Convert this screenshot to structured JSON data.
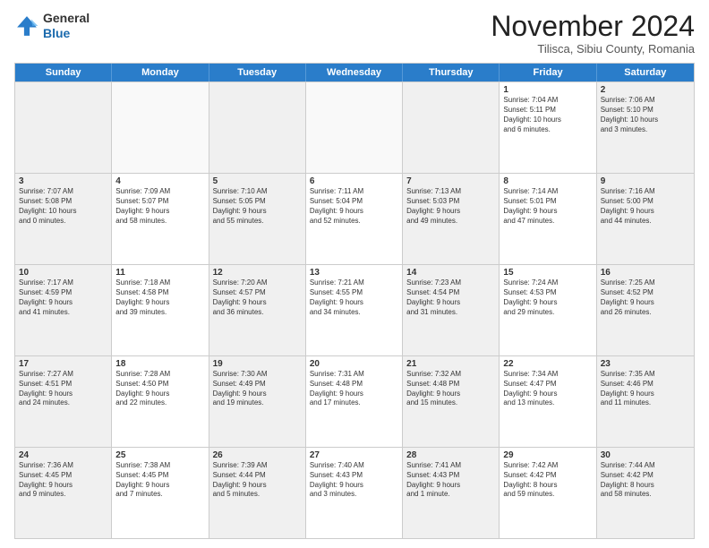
{
  "header": {
    "logo_general": "General",
    "logo_blue": "Blue",
    "month_title": "November 2024",
    "location": "Tilisca, Sibiu County, Romania"
  },
  "calendar": {
    "days": [
      "Sunday",
      "Monday",
      "Tuesday",
      "Wednesday",
      "Thursday",
      "Friday",
      "Saturday"
    ],
    "rows": [
      [
        {
          "day": "",
          "text": ""
        },
        {
          "day": "",
          "text": ""
        },
        {
          "day": "",
          "text": ""
        },
        {
          "day": "",
          "text": ""
        },
        {
          "day": "",
          "text": ""
        },
        {
          "day": "1",
          "text": "Sunrise: 7:04 AM\nSunset: 5:11 PM\nDaylight: 10 hours\nand 6 minutes."
        },
        {
          "day": "2",
          "text": "Sunrise: 7:06 AM\nSunset: 5:10 PM\nDaylight: 10 hours\nand 3 minutes."
        }
      ],
      [
        {
          "day": "3",
          "text": "Sunrise: 7:07 AM\nSunset: 5:08 PM\nDaylight: 10 hours\nand 0 minutes."
        },
        {
          "day": "4",
          "text": "Sunrise: 7:09 AM\nSunset: 5:07 PM\nDaylight: 9 hours\nand 58 minutes."
        },
        {
          "day": "5",
          "text": "Sunrise: 7:10 AM\nSunset: 5:05 PM\nDaylight: 9 hours\nand 55 minutes."
        },
        {
          "day": "6",
          "text": "Sunrise: 7:11 AM\nSunset: 5:04 PM\nDaylight: 9 hours\nand 52 minutes."
        },
        {
          "day": "7",
          "text": "Sunrise: 7:13 AM\nSunset: 5:03 PM\nDaylight: 9 hours\nand 49 minutes."
        },
        {
          "day": "8",
          "text": "Sunrise: 7:14 AM\nSunset: 5:01 PM\nDaylight: 9 hours\nand 47 minutes."
        },
        {
          "day": "9",
          "text": "Sunrise: 7:16 AM\nSunset: 5:00 PM\nDaylight: 9 hours\nand 44 minutes."
        }
      ],
      [
        {
          "day": "10",
          "text": "Sunrise: 7:17 AM\nSunset: 4:59 PM\nDaylight: 9 hours\nand 41 minutes."
        },
        {
          "day": "11",
          "text": "Sunrise: 7:18 AM\nSunset: 4:58 PM\nDaylight: 9 hours\nand 39 minutes."
        },
        {
          "day": "12",
          "text": "Sunrise: 7:20 AM\nSunset: 4:57 PM\nDaylight: 9 hours\nand 36 minutes."
        },
        {
          "day": "13",
          "text": "Sunrise: 7:21 AM\nSunset: 4:55 PM\nDaylight: 9 hours\nand 34 minutes."
        },
        {
          "day": "14",
          "text": "Sunrise: 7:23 AM\nSunset: 4:54 PM\nDaylight: 9 hours\nand 31 minutes."
        },
        {
          "day": "15",
          "text": "Sunrise: 7:24 AM\nSunset: 4:53 PM\nDaylight: 9 hours\nand 29 minutes."
        },
        {
          "day": "16",
          "text": "Sunrise: 7:25 AM\nSunset: 4:52 PM\nDaylight: 9 hours\nand 26 minutes."
        }
      ],
      [
        {
          "day": "17",
          "text": "Sunrise: 7:27 AM\nSunset: 4:51 PM\nDaylight: 9 hours\nand 24 minutes."
        },
        {
          "day": "18",
          "text": "Sunrise: 7:28 AM\nSunset: 4:50 PM\nDaylight: 9 hours\nand 22 minutes."
        },
        {
          "day": "19",
          "text": "Sunrise: 7:30 AM\nSunset: 4:49 PM\nDaylight: 9 hours\nand 19 minutes."
        },
        {
          "day": "20",
          "text": "Sunrise: 7:31 AM\nSunset: 4:48 PM\nDaylight: 9 hours\nand 17 minutes."
        },
        {
          "day": "21",
          "text": "Sunrise: 7:32 AM\nSunset: 4:48 PM\nDaylight: 9 hours\nand 15 minutes."
        },
        {
          "day": "22",
          "text": "Sunrise: 7:34 AM\nSunset: 4:47 PM\nDaylight: 9 hours\nand 13 minutes."
        },
        {
          "day": "23",
          "text": "Sunrise: 7:35 AM\nSunset: 4:46 PM\nDaylight: 9 hours\nand 11 minutes."
        }
      ],
      [
        {
          "day": "24",
          "text": "Sunrise: 7:36 AM\nSunset: 4:45 PM\nDaylight: 9 hours\nand 9 minutes."
        },
        {
          "day": "25",
          "text": "Sunrise: 7:38 AM\nSunset: 4:45 PM\nDaylight: 9 hours\nand 7 minutes."
        },
        {
          "day": "26",
          "text": "Sunrise: 7:39 AM\nSunset: 4:44 PM\nDaylight: 9 hours\nand 5 minutes."
        },
        {
          "day": "27",
          "text": "Sunrise: 7:40 AM\nSunset: 4:43 PM\nDaylight: 9 hours\nand 3 minutes."
        },
        {
          "day": "28",
          "text": "Sunrise: 7:41 AM\nSunset: 4:43 PM\nDaylight: 9 hours\nand 1 minute."
        },
        {
          "day": "29",
          "text": "Sunrise: 7:42 AM\nSunset: 4:42 PM\nDaylight: 8 hours\nand 59 minutes."
        },
        {
          "day": "30",
          "text": "Sunrise: 7:44 AM\nSunset: 4:42 PM\nDaylight: 8 hours\nand 58 minutes."
        }
      ]
    ]
  }
}
